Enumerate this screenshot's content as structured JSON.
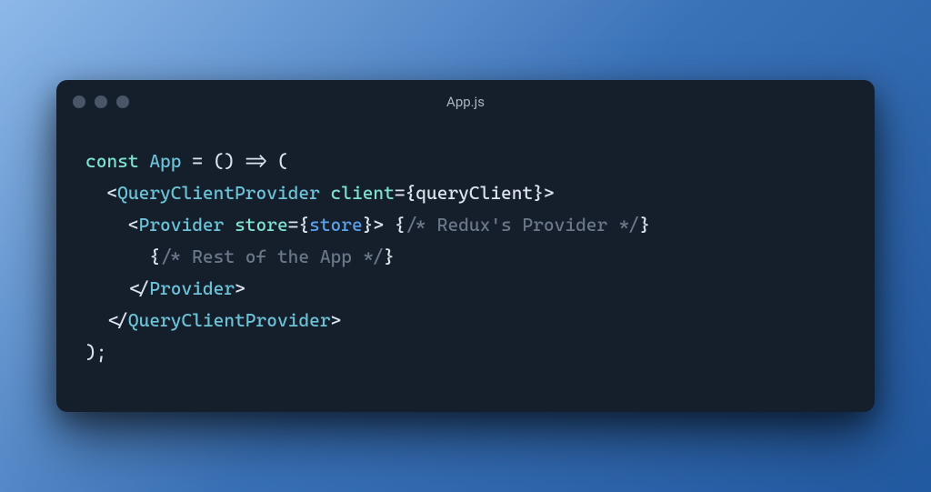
{
  "window": {
    "title": "App.js"
  },
  "code": {
    "l1": {
      "kw": "const",
      "fn": "App",
      "eq": " = () => ("
    },
    "l2": {
      "open": "<",
      "tag": "QueryClientProvider",
      "sp": " ",
      "attr": "client",
      "eq2": "=",
      "lb": "{",
      "ident": "queryClient",
      "rb": "}",
      "close": ">"
    },
    "l3": {
      "open": "<",
      "tag": "Provider",
      "sp": " ",
      "attr": "store",
      "eq2": "=",
      "lb": "{",
      "ident": "store",
      "rb": "}",
      "close": ">",
      "sp2": " ",
      "clb": "{",
      "comment": "/* Redux's Provider */",
      "crb": "}"
    },
    "l4": {
      "clb": "{",
      "comment": "/* Rest of the App */",
      "crb": "}"
    },
    "l5": {
      "open": "</",
      "tag": "Provider",
      "close": ">"
    },
    "l6": {
      "open": "</",
      "tag": "QueryClientProvider",
      "close": ">"
    },
    "l7": {
      "close_paren": ");"
    }
  }
}
